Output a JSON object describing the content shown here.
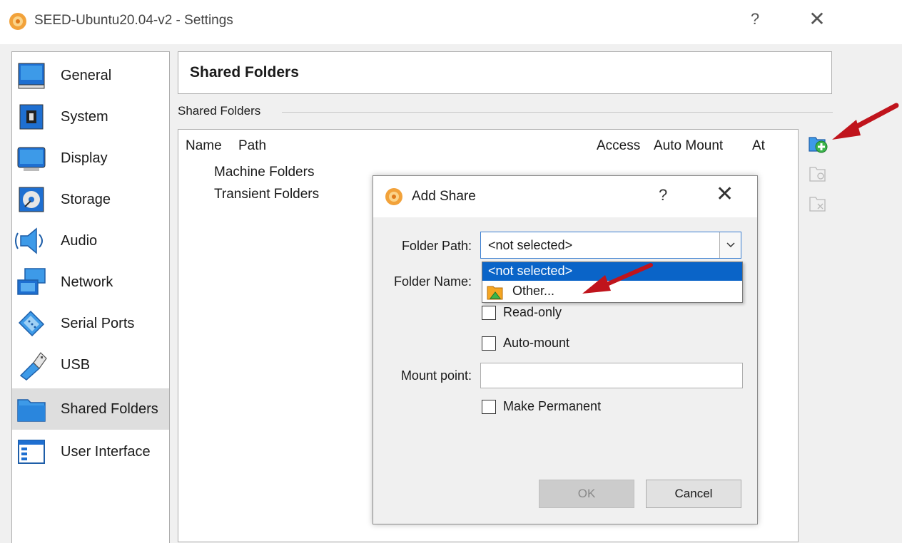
{
  "window": {
    "title": "SEED-Ubuntu20.04-v2 - Settings",
    "help_glyph": "?",
    "close_glyph": "✕"
  },
  "sidebar": {
    "items": [
      {
        "label": "General",
        "icon": "general-icon"
      },
      {
        "label": "System",
        "icon": "system-icon"
      },
      {
        "label": "Display",
        "icon": "display-icon"
      },
      {
        "label": "Storage",
        "icon": "storage-icon"
      },
      {
        "label": "Audio",
        "icon": "audio-icon"
      },
      {
        "label": "Network",
        "icon": "network-icon"
      },
      {
        "label": "Serial Ports",
        "icon": "serial-ports-icon"
      },
      {
        "label": "USB",
        "icon": "usb-icon"
      },
      {
        "label": "Shared Folders",
        "icon": "shared-folders-icon"
      },
      {
        "label": "User Interface",
        "icon": "user-interface-icon"
      }
    ],
    "active": "Shared Folders"
  },
  "main": {
    "page_title": "Shared Folders",
    "group_label": "Shared Folders",
    "table": {
      "columns": [
        "Name",
        "Path",
        "Access",
        "Auto Mount",
        "At"
      ],
      "rows": [
        "Machine Folders",
        "Transient Folders"
      ]
    },
    "tools": [
      "add-share-icon",
      "edit-share-icon",
      "remove-share-icon"
    ]
  },
  "dialog": {
    "title": "Add Share",
    "help_glyph": "?",
    "close_glyph": "✕",
    "folder_path_label": "Folder Path:",
    "folder_path_value": "<not selected>",
    "dropdown_options": [
      "<not selected>",
      "Other..."
    ],
    "folder_name_label": "Folder Name:",
    "readonly_label": "Read-only",
    "automount_label": "Auto-mount",
    "mount_point_label": "Mount point:",
    "mount_point_value": "",
    "make_permanent_label": "Make Permanent",
    "ok_label": "OK",
    "cancel_label": "Cancel"
  },
  "colors": {
    "accent": "#0a64c8",
    "annotation_arrow": "#c0141c"
  }
}
